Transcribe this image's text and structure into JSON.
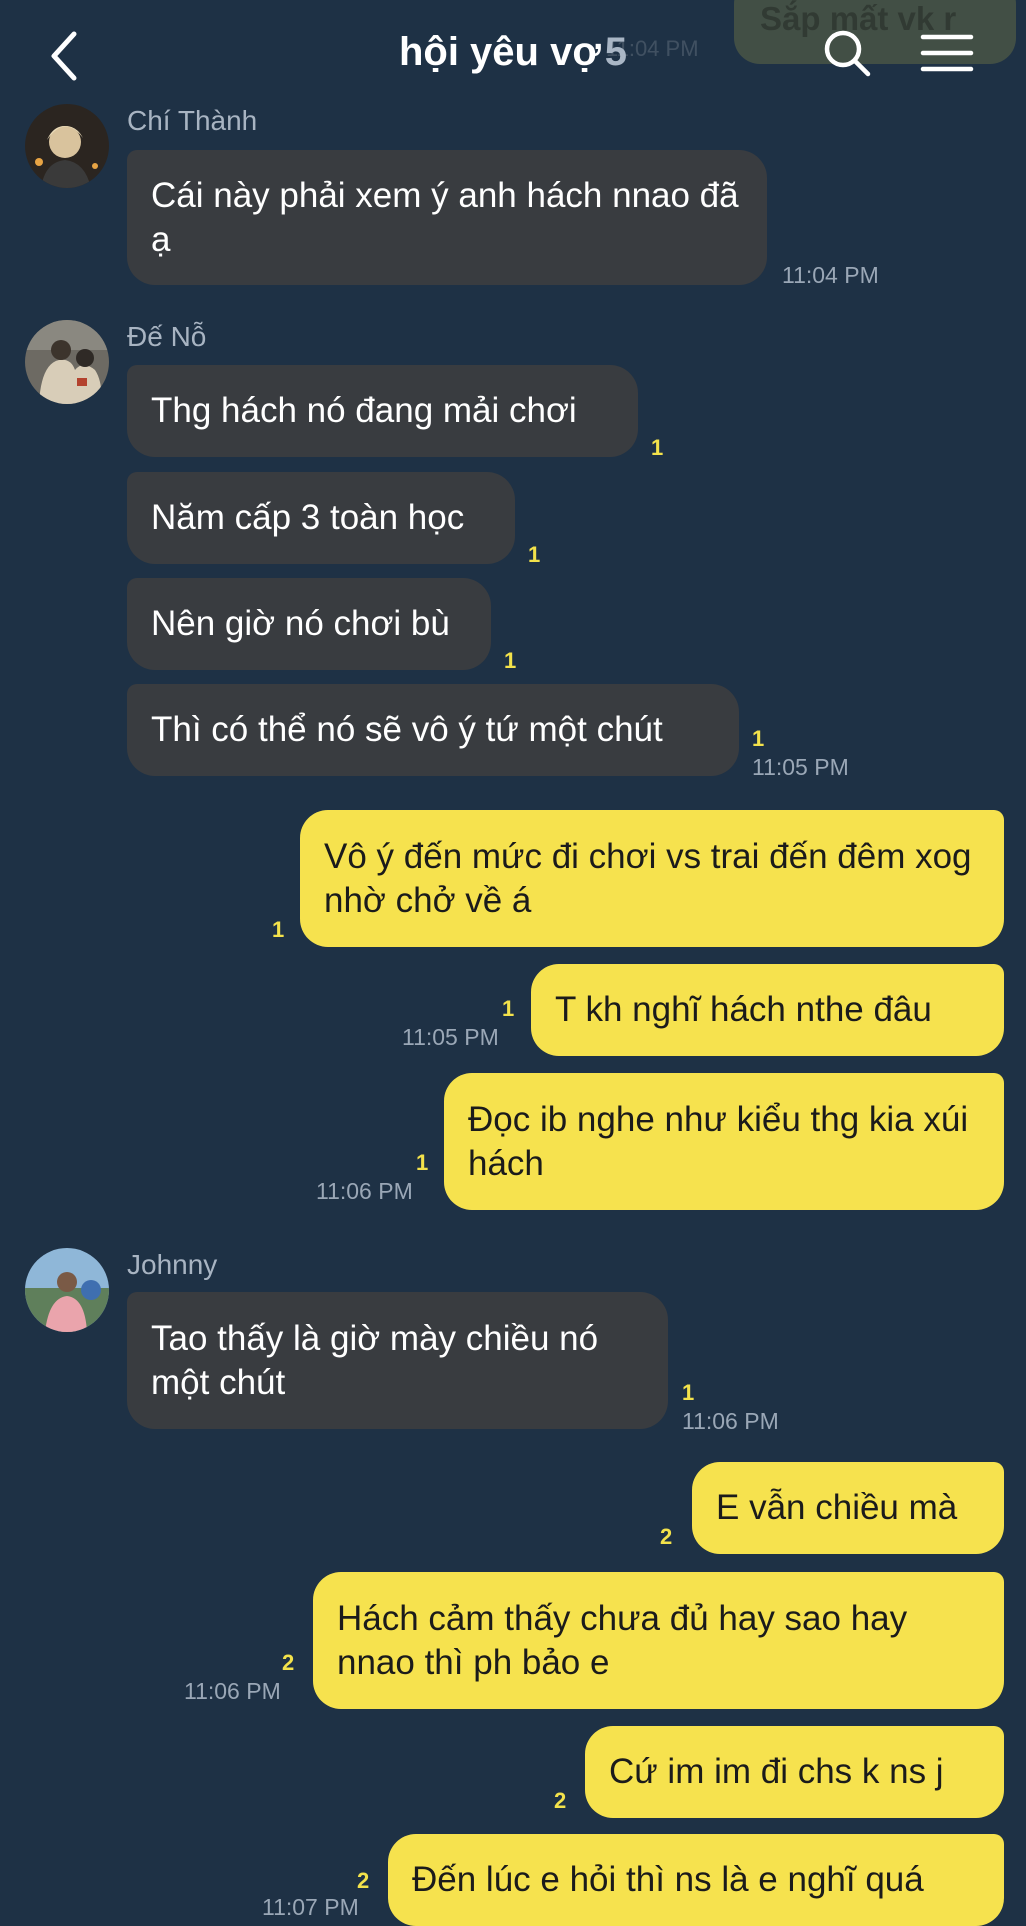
{
  "header": {
    "title": "hội yêu vợ",
    "member_count": "5",
    "back_icon": "chevron-left-icon",
    "search_icon": "search-icon",
    "menu_icon": "menu-icon",
    "behind_message": "Sắp mất vk r",
    "behind_time": "11:04 PM"
  },
  "colors": {
    "background": "#1e3145",
    "incoming_bubble": "#393c40",
    "outgoing_bubble": "#f6e24e",
    "unread_count": "#f3e24b"
  },
  "messages": [
    {
      "sender": "Chí Thành",
      "text": "Cái này phải xem ý anh hách nnao đã ạ",
      "time": "11:04 PM"
    },
    {
      "sender": "Đế Nỗ",
      "text": "Thg hách nó đang mải chơi",
      "unread": "1"
    },
    {
      "text": "Năm cấp 3 toàn học",
      "unread": "1"
    },
    {
      "text": "Nên giờ nó chơi bù",
      "unread": "1"
    },
    {
      "text": "Thì có thể nó sẽ vô ý tứ một chút",
      "unread": "1",
      "time": "11:05 PM"
    },
    {
      "text": "Vô ý đến mức đi chơi vs trai đến đêm xog nhờ chở về á",
      "unread": "1"
    },
    {
      "text": "T kh nghĩ hách nthe đâu",
      "unread": "1",
      "time": "11:05 PM"
    },
    {
      "text": "Đọc ib nghe như kiểu thg kia xúi hách",
      "unread": "1",
      "time": "11:06 PM"
    },
    {
      "sender": "Johnny",
      "text": "Tao thấy là giờ mày chiều nó một chút",
      "unread": "1",
      "time": "11:06 PM"
    },
    {
      "text": "E vẫn chiều mà",
      "unread": "2"
    },
    {
      "text": "Hách cảm thấy chưa đủ hay sao hay nnao thì ph bảo e",
      "unread": "2",
      "time": "11:06 PM"
    },
    {
      "text": "Cứ im im đi chs k ns j",
      "unread": "2"
    },
    {
      "text": "Đến lúc e hỏi thì ns là e nghĩ quá",
      "unread": "2",
      "time": "11:07 PM"
    }
  ]
}
